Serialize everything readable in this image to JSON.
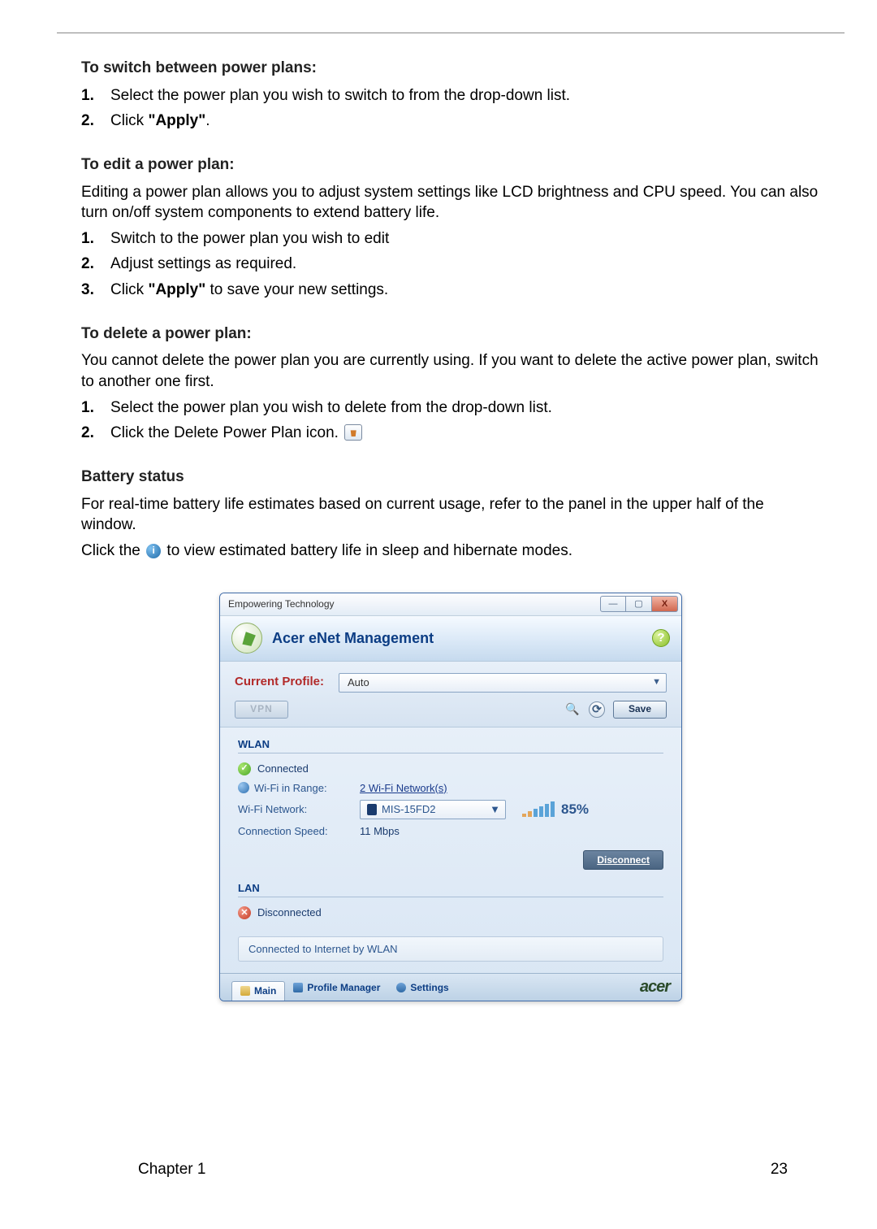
{
  "sections": {
    "switch": {
      "heading": "To switch between power plans:",
      "step1": "Select the power plan you wish to switch to from the drop-down list.",
      "step2a": "Click ",
      "step2b": "\"Apply\"",
      "step2c": "."
    },
    "edit": {
      "heading": "To edit a power plan:",
      "intro": "Editing a power plan allows you to adjust system settings like LCD brightness and CPU speed. You can also turn on/off system components to extend battery life.",
      "step1": "Switch to the power plan you wish to edit",
      "step2": "Adjust settings as required.",
      "step3a": "Click ",
      "step3b": "\"Apply\"",
      "step3c": " to save your new settings."
    },
    "del": {
      "heading": "To delete a power plan:",
      "intro": "You cannot delete the power plan you are currently using. If you want to delete the active power plan, switch to another one first.",
      "step1": "Select the power plan you wish to delete from the drop-down list.",
      "step2": "Click the Delete Power Plan icon."
    },
    "battery": {
      "heading": "Battery status",
      "p1": "For real-time battery life estimates based on current usage, refer to the panel in the upper half of the window.",
      "p2a": "Click the ",
      "p2b": " to view estimated battery life in sleep and hibernate modes."
    }
  },
  "app": {
    "titlebar": "Empowering Technology",
    "header_title": "Acer eNet Management",
    "help": "?",
    "profile_label": "Current Profile:",
    "profile_value": "Auto",
    "vpn": "VPN",
    "save": "Save",
    "wlan": {
      "title": "WLAN",
      "status": "Connected",
      "range_label": "Wi-Fi in Range:",
      "range_value": "2 Wi-Fi Network(s)",
      "net_label": "Wi-Fi Network:",
      "net_value": "MIS-15FD2",
      "signal_pct": "85%",
      "speed_label": "Connection Speed:",
      "speed_value": "11 Mbps",
      "disconnect": "Disconnect"
    },
    "lan": {
      "title": "LAN",
      "status": "Disconnected"
    },
    "internet_status": "Connected to Internet by WLAN",
    "tabs": {
      "main": "Main",
      "profile": "Profile Manager",
      "settings": "Settings"
    },
    "brand": "acer"
  },
  "footer": {
    "chapter": "Chapter 1",
    "page": "23"
  }
}
